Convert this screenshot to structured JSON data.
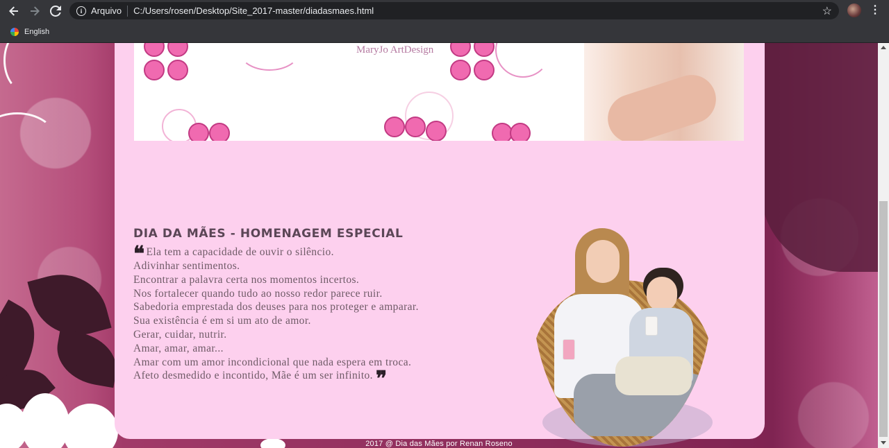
{
  "browser": {
    "scheme_label": "Arquivo",
    "url": "C:/Users/rosen/Desktop/Site_2017-master/diadasmaes.html",
    "icons": {
      "back": "arrow-left-icon",
      "forward": "arrow-right-icon",
      "reload": "reload-icon",
      "info": "info-icon",
      "bookmark": "star-icon",
      "menu": "kebab-menu-icon"
    },
    "bookmarks": [
      {
        "label": "English"
      }
    ]
  },
  "page": {
    "banner": {
      "credit": "MaryJo ArtDesign"
    },
    "heading": "DIA DA MÃES - HOMENAGEM ESPECIAL",
    "poem": [
      "Ela tem a capacidade de ouvir o silêncio.",
      "Adivinhar sentimentos.",
      "Encontrar a palavra certa nos momentos incertos.",
      "Nos fortalecer quando tudo ao nosso redor parece ruir.",
      "Sabedoria emprestada dos deuses para nos proteger e amparar.",
      "Sua existência é em si um ato de amor.",
      "Gerar, cuidar, nutrir.",
      "Amar, amar, amar...",
      "Amar com um amor incondicional que nada espera em troca.",
      "Afeto desmedido e incontido, Mãe é um ser infinito."
    ],
    "footer": "2017 @ Dia das Mães por Renan Roseno",
    "colors": {
      "card": "#fdd0ee",
      "heading": "#5b4656",
      "text": "#6e5a66"
    }
  }
}
